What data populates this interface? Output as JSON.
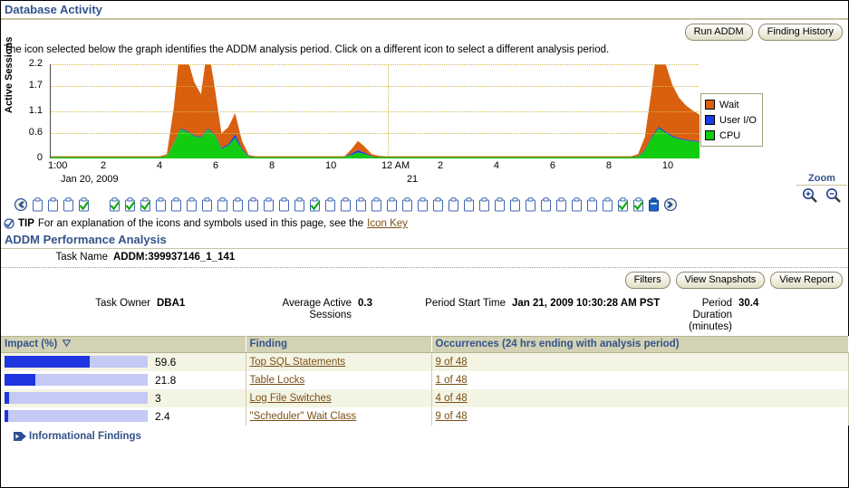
{
  "section": {
    "title": "Database Activity",
    "instruction": "The icon selected below the graph identifies the ADDM analysis period. Click on a different icon to select a different analysis period.",
    "buttons": [
      {
        "label": "Run ADDM",
        "name": "run-addm-button"
      },
      {
        "label": "Finding History",
        "name": "finding-history-button"
      }
    ]
  },
  "chart_data": {
    "type": "area",
    "title": "Database Activity",
    "xlabel": "",
    "ylabel": "Active Sessions",
    "ylim": [
      0,
      2.2
    ],
    "yticks": [
      "0",
      "0.6",
      "1.1",
      "1.7",
      "2.2"
    ],
    "ytick_values": [
      0,
      0.6,
      1.1,
      1.7,
      2.2
    ],
    "xticks": [
      "1:00",
      "2",
      "4",
      "6",
      "8",
      "10",
      "12 AM",
      "2",
      "4",
      "6",
      "8",
      "10"
    ],
    "x_date_labels": [
      "Jan 20, 2009",
      "21"
    ],
    "grid": true,
    "legend_position": "right",
    "stacked": true,
    "series": [
      {
        "name": "Wait",
        "color": "#d9600f",
        "values": [
          0.02,
          0.02,
          0.02,
          0.02,
          0.02,
          0.02,
          0.02,
          0.02,
          0.02,
          0.02,
          0.02,
          0.02,
          0.02,
          0.02,
          0.02,
          0.02,
          0.02,
          0.05,
          0.8,
          2.0,
          1.7,
          1.25,
          1.0,
          1.95,
          1.1,
          0.35,
          0.4,
          0.5,
          0.18,
          0.03,
          0.02,
          0.02,
          0.02,
          0.02,
          0.02,
          0.02,
          0.02,
          0.02,
          0.02,
          0.02,
          0.02,
          0.02,
          0.02,
          0.02,
          0.1,
          0.22,
          0.14,
          0.05,
          0.03,
          0.02,
          0.02,
          0.02,
          0.02,
          0.02,
          0.02,
          0.02,
          0.02,
          0.02,
          0.02,
          0.02,
          0.02,
          0.02,
          0.02,
          0.02,
          0.02,
          0.02,
          0.02,
          0.02,
          0.02,
          0.02,
          0.02,
          0.02,
          0.02,
          0.02,
          0.02,
          0.02,
          0.02,
          0.02,
          0.02,
          0.02,
          0.02,
          0.02,
          0.02,
          0.02,
          0.02,
          0.02,
          0.05,
          0.3,
          1.1,
          2.15,
          1.6,
          1.2,
          0.95,
          0.8,
          0.7,
          0.62
        ]
      },
      {
        "name": "User I/O",
        "color": "#1a3ce0",
        "values": [
          0,
          0,
          0,
          0,
          0,
          0,
          0,
          0,
          0,
          0,
          0,
          0,
          0,
          0,
          0,
          0,
          0,
          0,
          0.01,
          0.02,
          0.02,
          0.02,
          0.02,
          0.02,
          0.02,
          0.02,
          0.03,
          0.08,
          0.03,
          0.01,
          0,
          0,
          0,
          0,
          0,
          0,
          0,
          0,
          0,
          0,
          0,
          0,
          0,
          0,
          0.03,
          0.05,
          0.03,
          0.01,
          0,
          0,
          0,
          0,
          0,
          0,
          0,
          0,
          0,
          0,
          0,
          0,
          0,
          0,
          0,
          0,
          0,
          0,
          0,
          0,
          0,
          0,
          0,
          0,
          0,
          0,
          0,
          0,
          0,
          0,
          0,
          0,
          0,
          0,
          0,
          0,
          0,
          0,
          0.01,
          0.02,
          0.03,
          0.04,
          0.03,
          0.03,
          0.02,
          0.02,
          0.02,
          0.02
        ]
      },
      {
        "name": "CPU",
        "color": "#12cc12",
        "values": [
          0.03,
          0.03,
          0.03,
          0.03,
          0.03,
          0.03,
          0.03,
          0.03,
          0.03,
          0.03,
          0.03,
          0.03,
          0.03,
          0.03,
          0.03,
          0.03,
          0.03,
          0.05,
          0.35,
          0.68,
          0.62,
          0.52,
          0.48,
          0.68,
          0.55,
          0.22,
          0.3,
          0.48,
          0.2,
          0.04,
          0.03,
          0.03,
          0.03,
          0.03,
          0.03,
          0.03,
          0.03,
          0.03,
          0.03,
          0.03,
          0.03,
          0.03,
          0.03,
          0.03,
          0.08,
          0.14,
          0.1,
          0.04,
          0.03,
          0.03,
          0.03,
          0.03,
          0.03,
          0.03,
          0.03,
          0.03,
          0.03,
          0.03,
          0.03,
          0.03,
          0.03,
          0.03,
          0.03,
          0.03,
          0.03,
          0.03,
          0.03,
          0.03,
          0.03,
          0.03,
          0.03,
          0.03,
          0.03,
          0.03,
          0.03,
          0.03,
          0.03,
          0.03,
          0.03,
          0.03,
          0.03,
          0.03,
          0.03,
          0.03,
          0.03,
          0.03,
          0.04,
          0.18,
          0.48,
          0.7,
          0.6,
          0.5,
          0.45,
          0.42,
          0.4,
          0.38
        ]
      }
    ]
  },
  "legend": [
    {
      "label": "Wait",
      "color": "#d9600f"
    },
    {
      "label": "User I/O",
      "color": "#1a3ce0"
    },
    {
      "label": "CPU",
      "color": "#12cc12"
    }
  ],
  "zoom": {
    "title": "Zoom",
    "in_icon": "zoom-in-icon",
    "out_icon": "zoom-out-icon"
  },
  "snapshots": {
    "prev_icon": "previous-snapshots-icon",
    "next_icon": "next-snapshots-icon",
    "icons": [
      {
        "state": "plain"
      },
      {
        "state": "plain"
      },
      {
        "state": "plain"
      },
      {
        "state": "checked"
      },
      {
        "state": "gap"
      },
      {
        "state": "checked"
      },
      {
        "state": "checked"
      },
      {
        "state": "checked"
      },
      {
        "state": "plain"
      },
      {
        "state": "plain"
      },
      {
        "state": "plain"
      },
      {
        "state": "plain"
      },
      {
        "state": "plain"
      },
      {
        "state": "plain"
      },
      {
        "state": "plain"
      },
      {
        "state": "plain"
      },
      {
        "state": "plain"
      },
      {
        "state": "plain"
      },
      {
        "state": "checked"
      },
      {
        "state": "plain"
      },
      {
        "state": "plain"
      },
      {
        "state": "plain"
      },
      {
        "state": "plain"
      },
      {
        "state": "plain"
      },
      {
        "state": "plain"
      },
      {
        "state": "plain"
      },
      {
        "state": "plain"
      },
      {
        "state": "plain"
      },
      {
        "state": "plain"
      },
      {
        "state": "plain"
      },
      {
        "state": "plain"
      },
      {
        "state": "plain"
      },
      {
        "state": "plain"
      },
      {
        "state": "plain"
      },
      {
        "state": "plain"
      },
      {
        "state": "plain"
      },
      {
        "state": "plain"
      },
      {
        "state": "plain"
      },
      {
        "state": "checked"
      },
      {
        "state": "checked"
      },
      {
        "state": "selected"
      }
    ]
  },
  "tip": {
    "label": "TIP",
    "text": "For an explanation of the icons and symbols used in this page, see the",
    "link": "Icon Key"
  },
  "addm": {
    "title": "ADDM Performance Analysis",
    "task_name_label": "Task Name",
    "task_name_value": "ADDM:399937146_1_141",
    "buttons": [
      {
        "label": "Filters",
        "name": "filters-button"
      },
      {
        "label": "View Snapshots",
        "name": "view-snapshots-button"
      },
      {
        "label": "View Report",
        "name": "view-report-button"
      }
    ],
    "summary": [
      {
        "label": "Task Owner",
        "value": "DBA1"
      },
      {
        "label": "Average Active Sessions",
        "value": "0.3"
      },
      {
        "label": "Period Start Time",
        "value": "Jan 21, 2009 10:30:28 AM PST"
      },
      {
        "label": "Period Duration (minutes)",
        "value": "30.4"
      }
    ]
  },
  "table": {
    "columns": [
      "Impact (%)",
      "Finding",
      "Occurrences (24 hrs ending with analysis period)"
    ],
    "sorted_column": "Impact (%)",
    "sort_direction": "desc",
    "rows": [
      {
        "impact": "59.6",
        "impact_value": 59.6,
        "finding": "Top SQL Statements",
        "occurrences": "9 of 48"
      },
      {
        "impact": "21.8",
        "impact_value": 21.8,
        "finding": "Table Locks",
        "occurrences": "1 of 48"
      },
      {
        "impact": "3",
        "impact_value": 3.0,
        "finding": "Log File Switches",
        "occurrences": "4 of 48"
      },
      {
        "impact": "2.4",
        "impact_value": 2.4,
        "finding": "\"Scheduler\" Wait Class",
        "occurrences": "9 of 48"
      }
    ]
  },
  "footer": {
    "informational_findings": "Informational Findings"
  },
  "colors": {
    "header_text": "#33538b",
    "rule": "#c8c2a0",
    "table_header_bg": "#d3d2b4",
    "row_odd_bg": "#f4f4e4",
    "bar_fill": "#1f35e0",
    "bar_track": "#c4c9f5",
    "link": "#7a4f14",
    "wait": "#d9600f",
    "userio": "#1a3ce0",
    "cpu": "#12cc12"
  }
}
